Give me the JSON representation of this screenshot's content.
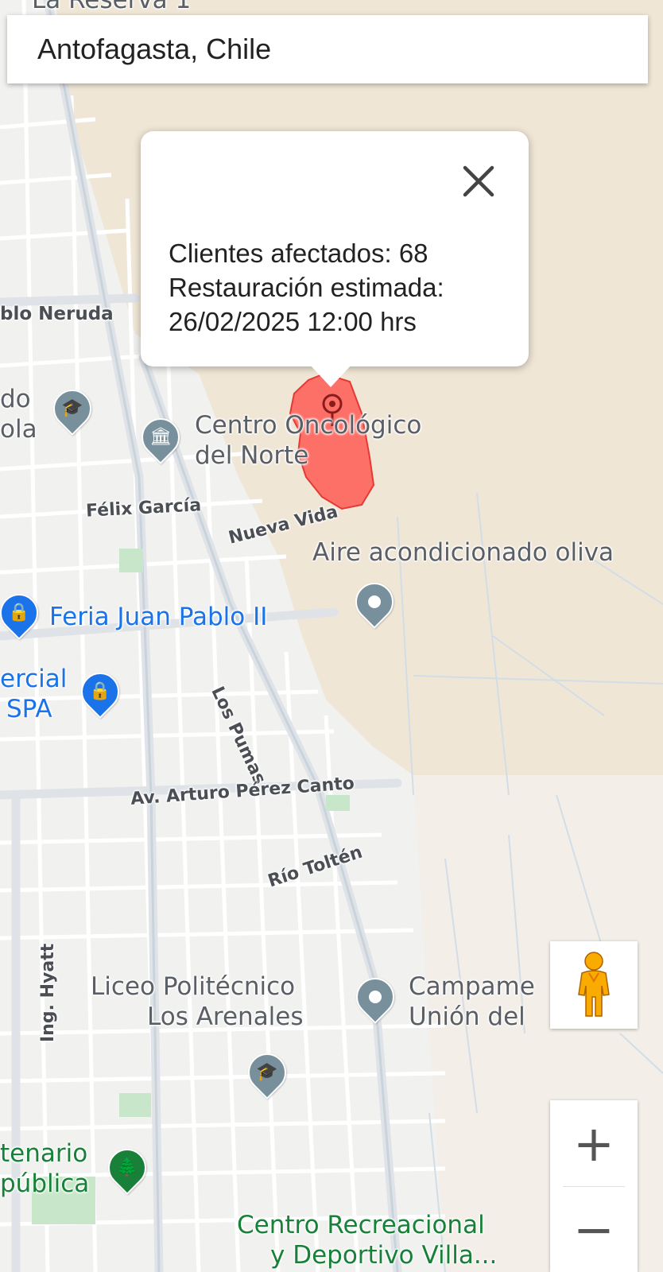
{
  "search": {
    "value": "Antofagasta, Chile"
  },
  "popup": {
    "line1": "Clientes afectados: 68",
    "line2": "Restauración estimada:",
    "line3": "26/02/2025 12:00 hrs",
    "close_icon": "close-icon"
  },
  "map_labels": {
    "top_partial": "La Reserva 1",
    "pablo_neruda": "blo Neruda",
    "colegio_do": "do",
    "colegio_ola": "ola",
    "centro_oncologico_1": "Centro Oncológico",
    "centro_oncologico_2": "del Norte",
    "felix_garcia": "Félix García",
    "nueva_vida": "Nueva Vida",
    "aire": "Aire acondicionado oliva",
    "feria": "Feria Juan Pablo II",
    "comercial_1": "ercial",
    "comercial_2": "SPA",
    "los_pumas": "Los Pumas",
    "arturo": "Av. Arturo Pérez Canto",
    "rio_tolten": "Río Toltén",
    "hyatt": "Ing. Hyatt",
    "liceo_1": "Liceo Politécnico",
    "liceo_2": "Los Arenales",
    "campamento_1": "Campame",
    "campamento_2": "Unión del",
    "centenario_1": "tenario",
    "centenario_2": "pública",
    "centro_rec_1": "Centro Recreacional",
    "centro_rec_2": "y Deportivo Villa..."
  },
  "controls": {
    "pegman": "pegman-icon",
    "zoom_in": "+",
    "zoom_out": "−"
  },
  "colors": {
    "outage_fill": "#ff5a55",
    "outage_stroke": "#e53935",
    "poi_grey": "#78909c",
    "poi_blue": "#1a73e8",
    "poi_green": "#188038",
    "sand": "#f0e6d6"
  }
}
